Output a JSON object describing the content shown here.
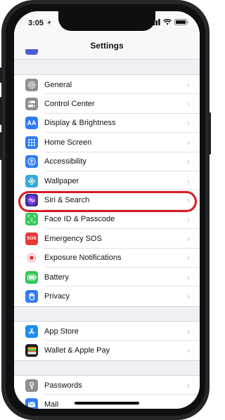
{
  "status": {
    "time": "3:05"
  },
  "nav": {
    "title": "Settings"
  },
  "groups": [
    {
      "items": [
        {
          "label": "General",
          "icon": "gear-icon",
          "color": "#8e8e93"
        },
        {
          "label": "Control Center",
          "icon": "toggles-icon",
          "color": "#8e8e93"
        },
        {
          "label": "Display & Brightness",
          "icon": "text-size-icon",
          "color": "#2f7cf6"
        },
        {
          "label": "Home Screen",
          "icon": "grid-icon",
          "color": "#2f7cf6"
        },
        {
          "label": "Accessibility",
          "icon": "accessibility-icon",
          "color": "#2f7cf6"
        },
        {
          "label": "Wallpaper",
          "icon": "flower-icon",
          "color": "#35aadc"
        },
        {
          "label": "Siri & Search",
          "icon": "siri-icon",
          "color": "#3a2f86"
        },
        {
          "label": "Face ID & Passcode",
          "icon": "face-id-icon",
          "color": "#34c759"
        },
        {
          "label": "Emergency SOS",
          "icon": "sos-icon",
          "color": "#e53935"
        },
        {
          "label": "Exposure Notifications",
          "icon": "exposure-icon",
          "color": "#ffffff"
        },
        {
          "label": "Battery",
          "icon": "battery-icon",
          "color": "#34c759"
        },
        {
          "label": "Privacy",
          "icon": "hand-icon",
          "color": "#2f7cf6"
        }
      ]
    },
    {
      "items": [
        {
          "label": "App Store",
          "icon": "app-store-icon",
          "color": "#1b8cf3"
        },
        {
          "label": "Wallet & Apple Pay",
          "icon": "wallet-icon",
          "color": "#1c1c1e"
        }
      ]
    },
    {
      "items": [
        {
          "label": "Passwords",
          "icon": "key-icon",
          "color": "#8e8e93"
        },
        {
          "label": "Mail",
          "icon": "mail-icon",
          "color": "#2f7cf6"
        }
      ]
    }
  ],
  "highlight": {
    "item": "Siri & Search",
    "color": "#d81b23"
  }
}
